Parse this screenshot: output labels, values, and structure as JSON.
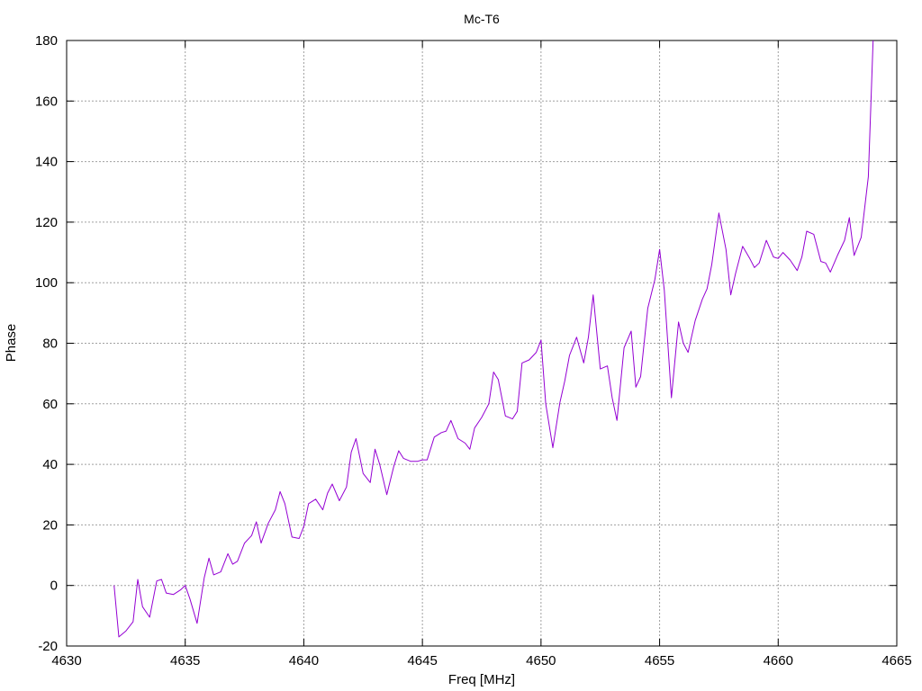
{
  "chart_data": {
    "type": "line",
    "title": "Mc-T6",
    "xlabel": "Freq [MHz]",
    "ylabel": "Phase",
    "xlim": [
      4630,
      4665
    ],
    "ylim": [
      -20,
      180
    ],
    "xticks": [
      4630,
      4635,
      4640,
      4645,
      4650,
      4655,
      4660,
      4665
    ],
    "yticks": [
      -20,
      0,
      20,
      40,
      60,
      80,
      100,
      120,
      140,
      160,
      180
    ],
    "grid": true,
    "line_color": "#9400d3",
    "series": [
      {
        "x": [
          4632.0,
          4632.2,
          4632.5,
          4632.8,
          4633.0,
          4633.2,
          4633.5,
          4633.8,
          4634.0,
          4634.2,
          4634.5,
          4634.8,
          4635.0,
          4635.2,
          4635.5,
          4635.8,
          4636.0,
          4636.2,
          4636.5,
          4636.8,
          4637.0,
          4637.2,
          4637.5,
          4637.8,
          4638.0,
          4638.2,
          4638.5,
          4638.8,
          4639.0,
          4639.2,
          4639.5,
          4639.8,
          4640.0,
          4640.2,
          4640.5,
          4640.8,
          4641.0,
          4641.2,
          4641.5,
          4641.8,
          4642.0,
          4642.2,
          4642.5,
          4642.8,
          4643.0,
          4643.2,
          4643.5,
          4643.8,
          4644.0,
          4644.2,
          4644.5,
          4644.8,
          4645.0,
          4645.2,
          4645.5,
          4645.8,
          4646.0,
          4646.2,
          4646.5,
          4646.8,
          4647.0,
          4647.2,
          4647.5,
          4647.8,
          4648.0,
          4648.2,
          4648.5,
          4648.8,
          4649.0,
          4649.2,
          4649.5,
          4649.8,
          4650.0,
          4650.2,
          4650.5,
          4650.8,
          4651.0,
          4651.2,
          4651.5,
          4651.8,
          4652.0,
          4652.2,
          4652.5,
          4652.8,
          4653.0,
          4653.2,
          4653.5,
          4653.8,
          4654.0,
          4654.2,
          4654.5,
          4654.8,
          4655.0,
          4655.2,
          4655.5,
          4655.8,
          4656.0,
          4656.2,
          4656.5,
          4656.8,
          4657.0,
          4657.2,
          4657.5,
          4657.8,
          4658.0,
          4658.2,
          4658.5,
          4658.8,
          4659.0,
          4659.2,
          4659.5,
          4659.8,
          4660.0,
          4660.2,
          4660.5,
          4660.8,
          4661.0,
          4661.2,
          4661.5,
          4661.8,
          4662.0,
          4662.2,
          4662.5,
          4662.8,
          4663.0,
          4663.2,
          4663.5,
          4663.8,
          4664.0
        ],
        "y": [
          0,
          -17,
          -15,
          -12,
          2,
          -7,
          -10.5,
          1.5,
          2,
          -2.5,
          -3,
          -1.5,
          0,
          -4.5,
          -12.5,
          2.5,
          9,
          3.5,
          4.5,
          10.5,
          7,
          8,
          14,
          16.5,
          21,
          14,
          20.5,
          25,
          31,
          27,
          16,
          15.5,
          19.5,
          27,
          28.5,
          25,
          30.5,
          33.5,
          28,
          32.5,
          44,
          48.5,
          37,
          34,
          45,
          40,
          30,
          39.5,
          44.5,
          42,
          41,
          41,
          41.5,
          41.5,
          49,
          50.5,
          51,
          54.5,
          48.5,
          47,
          45,
          52,
          55.5,
          60,
          70.5,
          68,
          56,
          55,
          57.5,
          73.5,
          74.5,
          77,
          81,
          60,
          45.5,
          60.5,
          67.5,
          76,
          82,
          73.5,
          82,
          96,
          71.5,
          72.5,
          62,
          54.5,
          78.5,
          84,
          65.5,
          69,
          91.5,
          101,
          111,
          97.5,
          62,
          87,
          80,
          77,
          87.5,
          94.5,
          98,
          106,
          123,
          111,
          96,
          103,
          112,
          108,
          105,
          106.5,
          114,
          108.5,
          108,
          110,
          107.5,
          104,
          108.5,
          117,
          116,
          107,
          106.5,
          103.5,
          109,
          114,
          121.5,
          109,
          115,
          135,
          180
        ]
      }
    ]
  }
}
